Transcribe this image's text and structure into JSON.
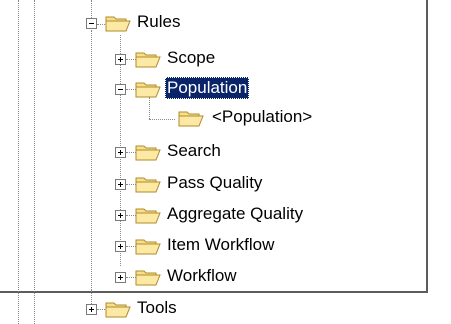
{
  "tree": {
    "nodes": [
      {
        "label": "Rules",
        "expanded": true
      },
      {
        "label": "Scope",
        "expanded": false
      },
      {
        "label": "Population",
        "expanded": true,
        "selected": true
      },
      {
        "label": "<Population>"
      },
      {
        "label": "Search",
        "expanded": false
      },
      {
        "label": "Pass Quality",
        "expanded": false
      },
      {
        "label": "Aggregate Quality",
        "expanded": false
      },
      {
        "label": "Item Workflow",
        "expanded": false
      },
      {
        "label": "Workflow",
        "expanded": false
      },
      {
        "label": "Tools",
        "expanded": false
      }
    ]
  },
  "colors": {
    "selection": "#0a246a",
    "folder_fill": "#f7e08a",
    "folder_edge": "#b08a2a"
  }
}
